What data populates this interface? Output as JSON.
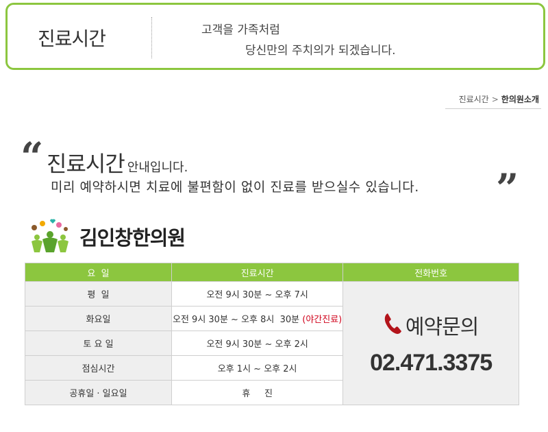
{
  "header": {
    "title": "진료시간",
    "slogan_line1": "고객을 가족처럼",
    "slogan_line2": "당신만의 주치의가 되겠습니다."
  },
  "breadcrumb": {
    "items": [
      "진료시간",
      "한의원소개"
    ],
    "separator": ">"
  },
  "intro": {
    "title": "진료시간",
    "title_suffix": "안내입니다.",
    "subtitle": "미리 예약하시면 치료에 불편함이 없이 진료를 받으실수 있습니다.",
    "open_quote": "“",
    "close_quote": "”"
  },
  "clinic": {
    "name": "김인창한의원",
    "logo_icon": "people-flowers-icon"
  },
  "table": {
    "headers": [
      "요  일",
      "진료시간",
      "전화번호"
    ],
    "rows": [
      {
        "day": "평  일",
        "time": "오전 9시 30분 ~ 오후 7시",
        "time_note": ""
      },
      {
        "day": "화요일",
        "time": "오전 9시 30분 ~ 오후 8시  30분",
        "time_note": "(야간진료)"
      },
      {
        "day": "토 요 일",
        "time": "오전 9시 30분 ~ 오후 2시",
        "time_note": ""
      },
      {
        "day": "점심시간",
        "time": "오후 1시 ~ 오후 2시",
        "time_note": ""
      },
      {
        "day": "공휴일 · 일요일",
        "time": "휴     진",
        "time_note": ""
      }
    ],
    "phone": {
      "label": "예약문의",
      "number": "02.471.3375",
      "icon": "phone-icon"
    }
  },
  "colors": {
    "accent_green": "#8cc63f",
    "holiday_red": "#d0021b",
    "cell_gray": "#efefef"
  }
}
